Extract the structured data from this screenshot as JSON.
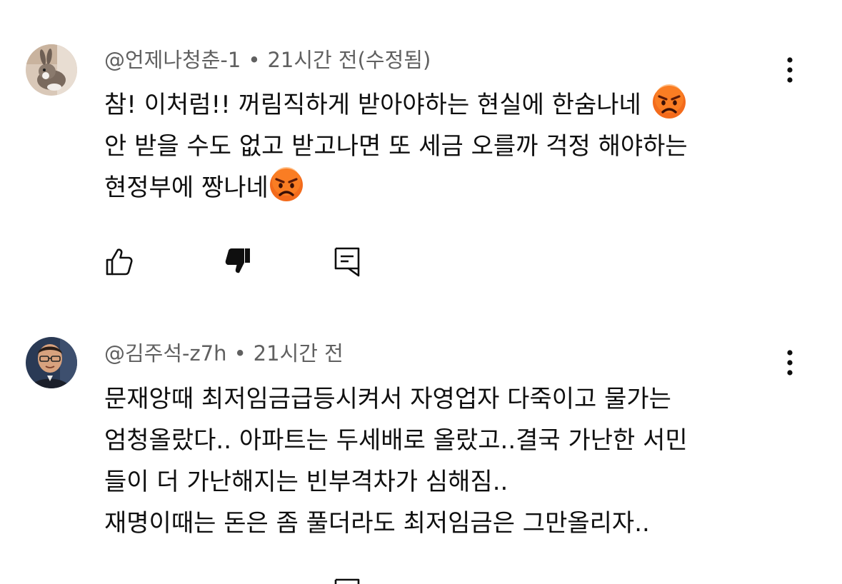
{
  "comments": [
    {
      "author": "@언제나청춘-1",
      "separator": "•",
      "time": "21시간 전(수정됨)",
      "avatar_icon": "rabbit-avatar",
      "lines": [
        "참! 이처럼!! 꺼림직하게 받아야하는 현실에  한숨나네",
        "안 받을 수도 없고 받고나면 또 세금 오를까 걱정 해야하는",
        "현정부에 짱나네"
      ],
      "emoji": "angry-face-emoji",
      "actions": [
        "like-icon",
        "dislike-icon",
        "reply-icon"
      ],
      "menu_icon": "more-vert-icon"
    },
    {
      "author": "@김주석-z7h",
      "separator": "•",
      "time": "21시간 전",
      "avatar_icon": "man-glasses-avatar",
      "lines": [
        "문재앙때 최저임금급등시켜서 자영업자 다죽이고 물가는",
        "엄청올랐다.. 아파트는 두세배로 올랐고..결국 가난한 서민",
        "들이 더 가난해지는 빈부격차가 심해짐..",
        "재명이때는 돈은 좀 풀더라도 최저임금은 그만올리자.."
      ],
      "actions": [
        "reply-icon"
      ],
      "menu_icon": "more-vert-icon"
    }
  ],
  "colors": {
    "text": "#0f0f0f",
    "meta": "#606060",
    "emoji_face": "#f36b1c"
  }
}
